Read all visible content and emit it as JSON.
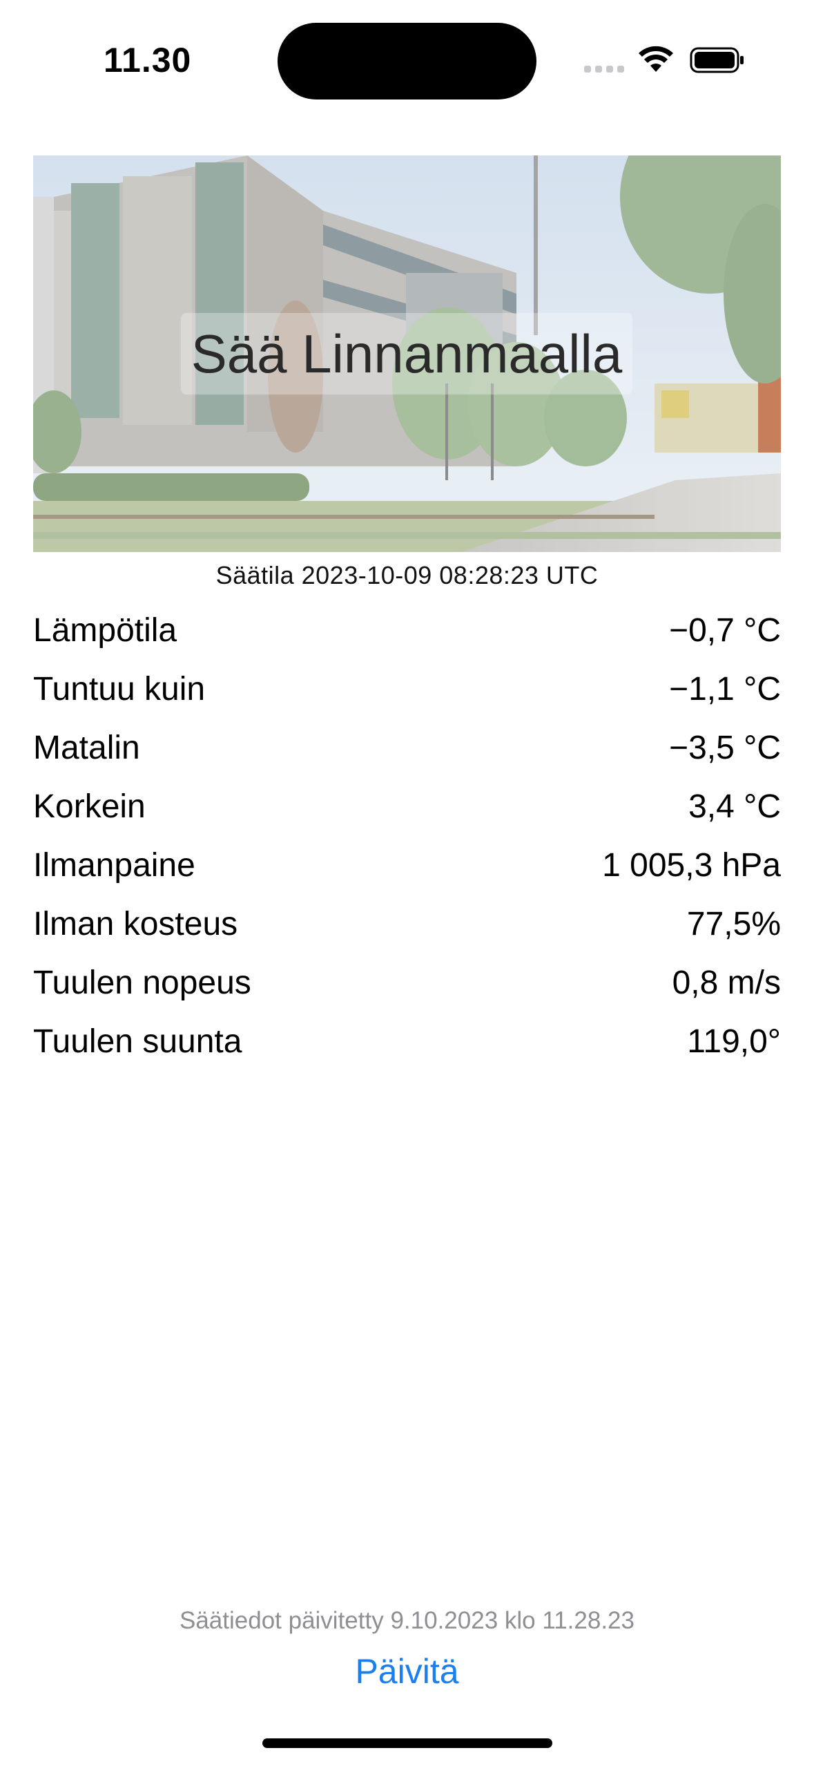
{
  "status_bar": {
    "time": "11.30",
    "icons": [
      "cellular-signal-icon",
      "wifi-icon",
      "battery-icon"
    ]
  },
  "hero": {
    "title": "Sää Linnanmaalla",
    "image": "building-photo"
  },
  "weather_state": "Säätila 2023-10-09 08:28:23 UTC",
  "rows": [
    {
      "label": "Lämpötila",
      "value": "−0,7 °C"
    },
    {
      "label": "Tuntuu kuin",
      "value": "−1,1 °C"
    },
    {
      "label": "Matalin",
      "value": "−3,5 °C"
    },
    {
      "label": "Korkein",
      "value": "3,4 °C"
    },
    {
      "label": "Ilmanpaine",
      "value": "1 005,3 hPa"
    },
    {
      "label": "Ilman kosteus",
      "value": "77,5%"
    },
    {
      "label": "Tuulen nopeus",
      "value": "0,8 m/s"
    },
    {
      "label": "Tuulen suunta",
      "value": "119,0°"
    }
  ],
  "footer": {
    "updated_text": "Säätiedot päivitetty 9.10.2023 klo 11.28.23",
    "refresh_label": "Päivitä"
  },
  "colors": {
    "accent": "#1a7ff0",
    "secondary_text": "#8e8e93"
  }
}
